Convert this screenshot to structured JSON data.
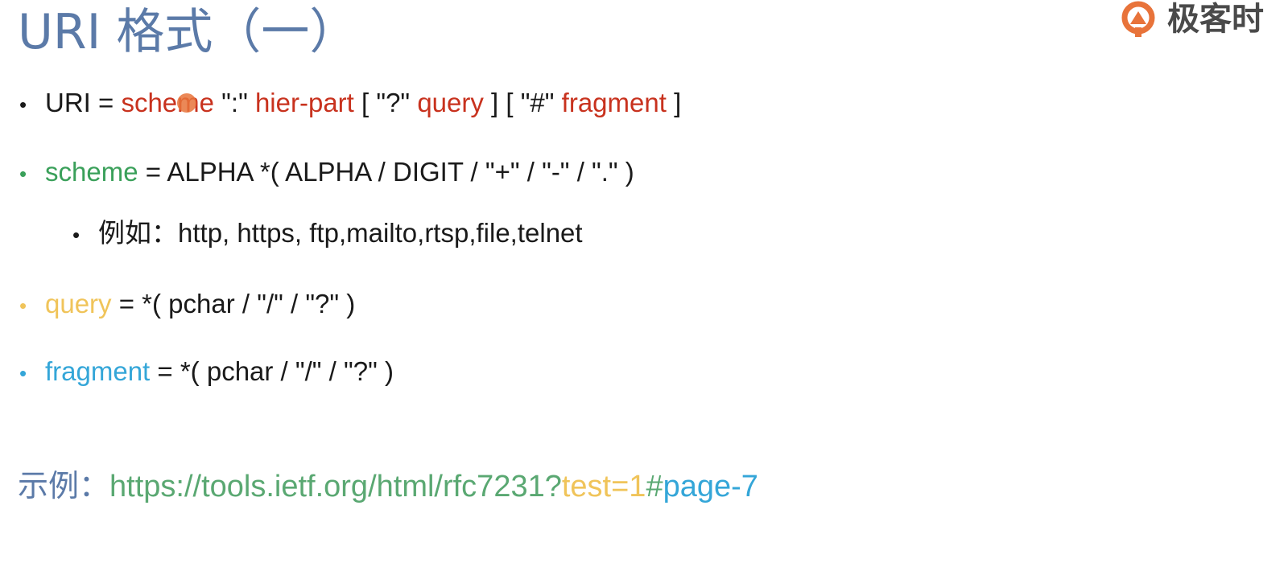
{
  "title": "URI 格式（一）",
  "logo": {
    "text": "极客时"
  },
  "colors": {
    "title": "#5b7aa8",
    "scheme_red": "#c8321e",
    "scheme_green": "#3aa05a",
    "query_yellow": "#f0c45a",
    "fragment_blue": "#34a6d8"
  },
  "lines": {
    "uri": {
      "bullet": "•",
      "part1": "URI = ",
      "scheme": "scheme",
      "part2": " \":\" ",
      "hier": "hier-part",
      "part3": " [ \"?\" ",
      "query": "query",
      "part4": " ] [ \"#\" ",
      "fragment": "fragment",
      "part5": " ]"
    },
    "scheme": {
      "bullet": "•",
      "name": "scheme",
      "rest": " = ALPHA *( ALPHA / DIGIT / \"+\" / \"-\" / \".\" )"
    },
    "example_schemes": {
      "bullet": "•",
      "text": "例如：http, https, ftp,mailto,rtsp,file,telnet"
    },
    "query": {
      "bullet": "•",
      "name": "query",
      "rest": " = *( pchar / \"/\" / \"?\" )"
    },
    "fragment": {
      "bullet": "•",
      "name": "fragment",
      "rest": " = *( pchar / \"/\" / \"?\" )"
    }
  },
  "example": {
    "label": "示例：",
    "url_base": "https://tools.ietf.org/html/rfc7231?",
    "url_query": "test=1",
    "url_hash": "#",
    "url_fragment": "page-7"
  }
}
